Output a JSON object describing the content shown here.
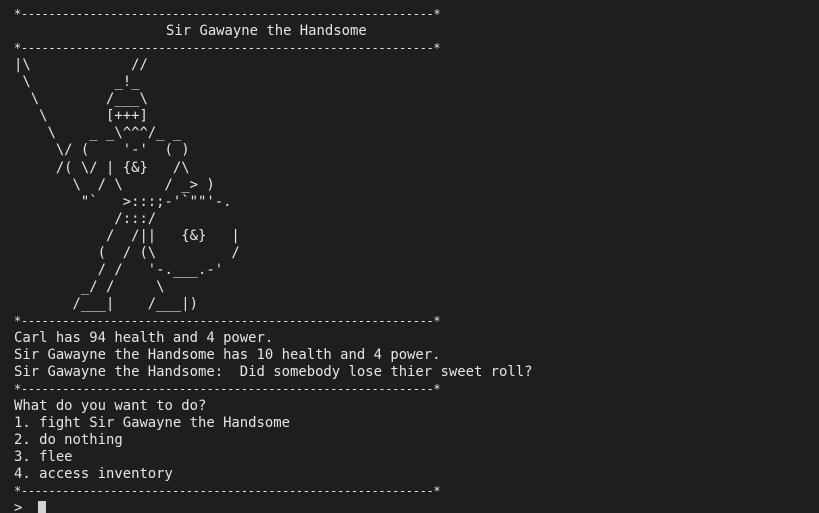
{
  "terminal": {
    "separator": "*------------------------------------------------------------*",
    "header_title": "Sir Gawayne the Handsome",
    "ascii_art": "|\\            //\n \\          _!_\n  \\        /___\\\n   \\       [+++]\n    \\    _ _\\^^^/_ _\n     \\/ (    '-'  ( )\n     /( \\/ | {&}   /\\\n       \\  / \\     / _> )\n        \"`   >:::;-'`\"\"'-.\n            /:::/\n           /  /||   {&}   |\n          (  / (\\         /\n          / /   '-.___.-'\n        _/ /     \\\n       /___|    /___|)",
    "status": [
      "Carl has 94 health and 4 power.",
      "Sir Gawayne the Handsome has 10 health and 4 power.",
      "Sir Gawayne the Handsome:  Did somebody lose thier sweet roll?"
    ],
    "menu_prompt": "What do you want to do?",
    "menu_options": [
      "1. fight Sir Gawayne the Handsome",
      "2. do nothing",
      "3. flee",
      "4. access inventory"
    ],
    "input_prompt": ">",
    "input_value": ""
  },
  "colors": {
    "background": "#1e1e1e",
    "text": "#e6e6e6",
    "cursor": "#d4d4d4"
  }
}
